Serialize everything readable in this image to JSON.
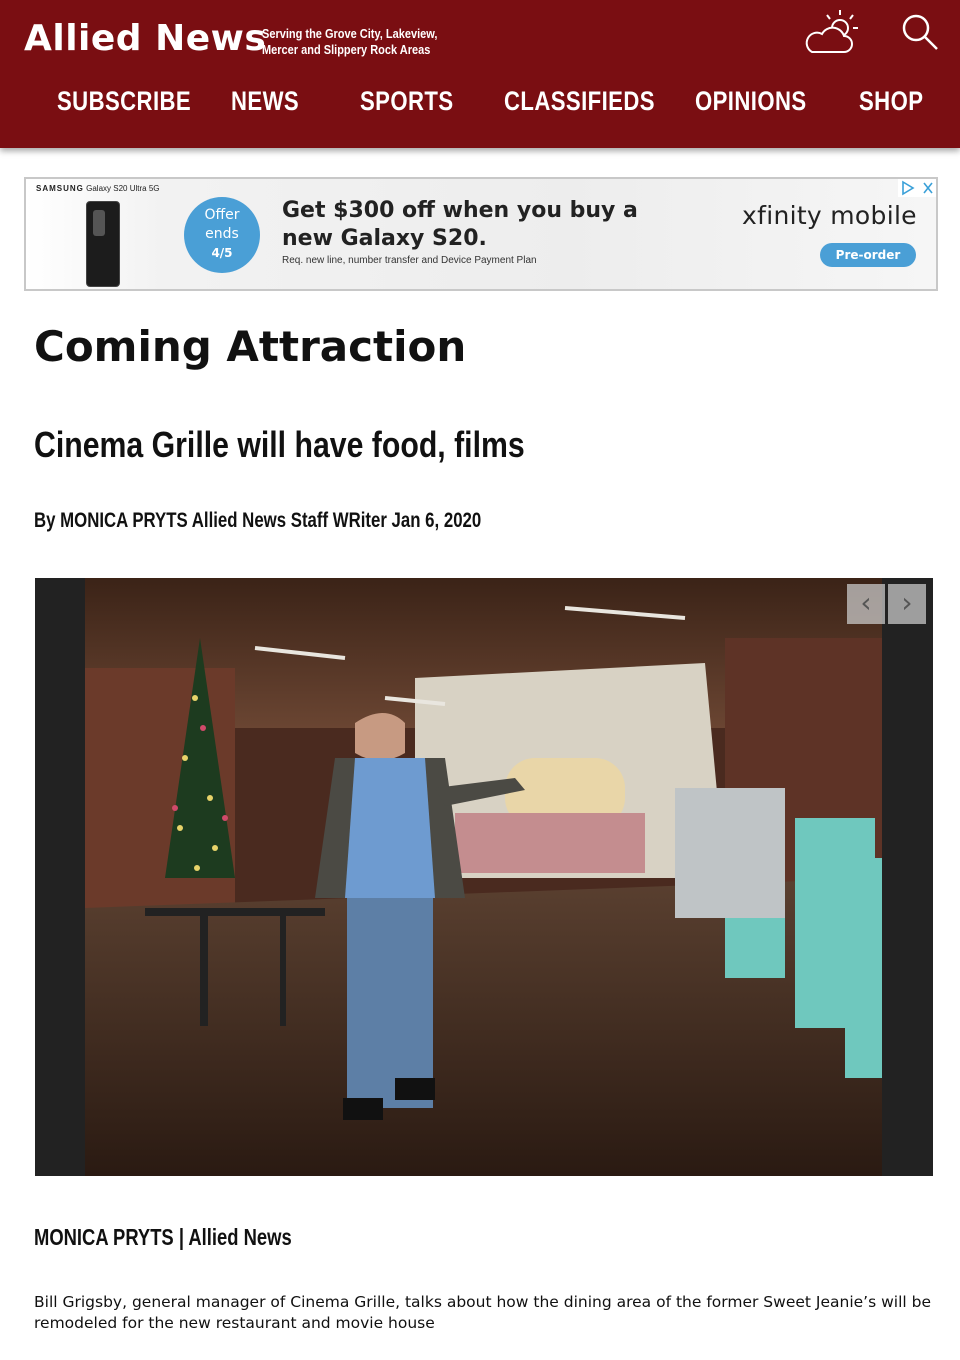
{
  "header": {
    "logo": "Allied News",
    "tagline": "Serving the Grove City, Lakeview, Mercer and Slippery Rock Areas",
    "weather_icon": "partly-cloudy-icon",
    "search_icon": "search-icon",
    "nav": [
      {
        "label": "SUBSCRIBE"
      },
      {
        "label": "NEWS"
      },
      {
        "label": "SPORTS"
      },
      {
        "label": "CLASSIFIEDS"
      },
      {
        "label": "OPINIONS"
      },
      {
        "label": "SHOP"
      }
    ],
    "colors": {
      "brand": "#7a0e12",
      "text": "#ffffff"
    }
  },
  "ad": {
    "brand_prefix": "SAMSUNG",
    "brand_model": "Galaxy S20 Ultra 5G",
    "offer_line1": "Offer",
    "offer_line2": "ends",
    "offer_date": "4/5",
    "headline": "Get $300 off when you buy a new Galaxy S20.",
    "fine_print": "Req. new line, number transfer and Device Payment Plan",
    "advertiser": "xfinity mobile",
    "cta": "Pre-order",
    "accent": "#4a9fd6"
  },
  "article": {
    "section": "Coming Attraction",
    "headline": "Cinema Grille will have food, films",
    "byline_prefix": "By",
    "author": "MONICA PRYTS",
    "author_title": "Allied News Staff WRiter",
    "date": "Jan 6, 2020",
    "photo_credit": "MONICA PRYTS | Allied News",
    "caption": "Bill Grigsby, general manager of Cinema Grille, talks about how the dining area of the former Sweet Jeanie’s will be remodeled for the new restaurant and movie house"
  },
  "gallery": {
    "prev_icon": "chevron-left-icon",
    "next_icon": "chevron-right-icon"
  }
}
